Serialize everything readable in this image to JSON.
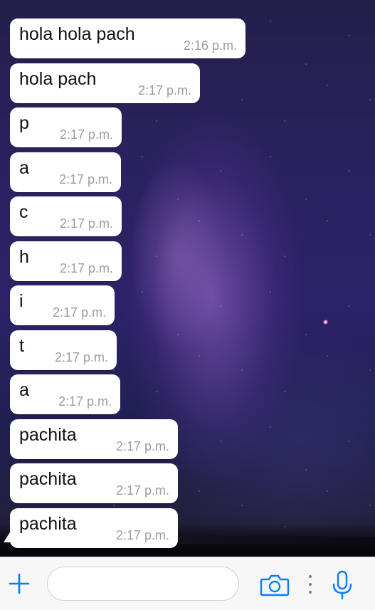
{
  "chat": {
    "messages": [
      {
        "text": "hola hola pach",
        "time": "2:16 p.m."
      },
      {
        "text": "hola pach",
        "time": "2:17 p.m."
      },
      {
        "text": "p",
        "time": "2:17 p.m."
      },
      {
        "text": "a",
        "time": "2:17 p.m."
      },
      {
        "text": "c",
        "time": "2:17 p.m."
      },
      {
        "text": "h",
        "time": "2:17 p.m."
      },
      {
        "text": "i",
        "time": "2:17 p.m."
      },
      {
        "text": "t",
        "time": "2:17 p.m."
      },
      {
        "text": "a",
        "time": "2:17 p.m."
      },
      {
        "text": "pachita",
        "time": "2:17 p.m."
      },
      {
        "text": "pachita",
        "time": "2:17 p.m."
      },
      {
        "text": "pachita",
        "time": "2:17 p.m."
      }
    ]
  },
  "input_bar": {
    "placeholder": "",
    "value": "",
    "icons": {
      "attach": "plus-icon",
      "camera": "camera-icon",
      "more": "more-vertical-icon",
      "microphone": "microphone-icon"
    },
    "accent_color": "#0a7cff"
  },
  "theme": {
    "bubble_color": "#ffffff",
    "time_color": "#9c9c9c"
  }
}
